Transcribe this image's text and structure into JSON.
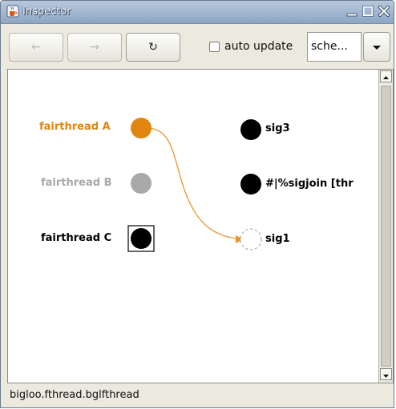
{
  "window": {
    "title": "Inspector"
  },
  "toolbar": {
    "back_label": "←",
    "forward_label": "→",
    "refresh_label": "↻",
    "auto_update_label": "auto update",
    "auto_update_checked": false,
    "combo_value": "sche..."
  },
  "threads": [
    {
      "label": "fairthread A",
      "color": "#e0860f",
      "state": "active"
    },
    {
      "label": "fairthread B",
      "color": "#a9a9a9",
      "state": "inactive"
    },
    {
      "label": "fairthread C",
      "color": "#000000",
      "state": "selected"
    }
  ],
  "signals": [
    {
      "label": "sig3",
      "state": "filled"
    },
    {
      "label": "#|%sigjoin [thr",
      "state": "filled"
    },
    {
      "label": "sig1",
      "state": "pending"
    }
  ],
  "edge_color": "#e8952e",
  "status": {
    "text": "bigloo.fthread.bglfthread"
  }
}
